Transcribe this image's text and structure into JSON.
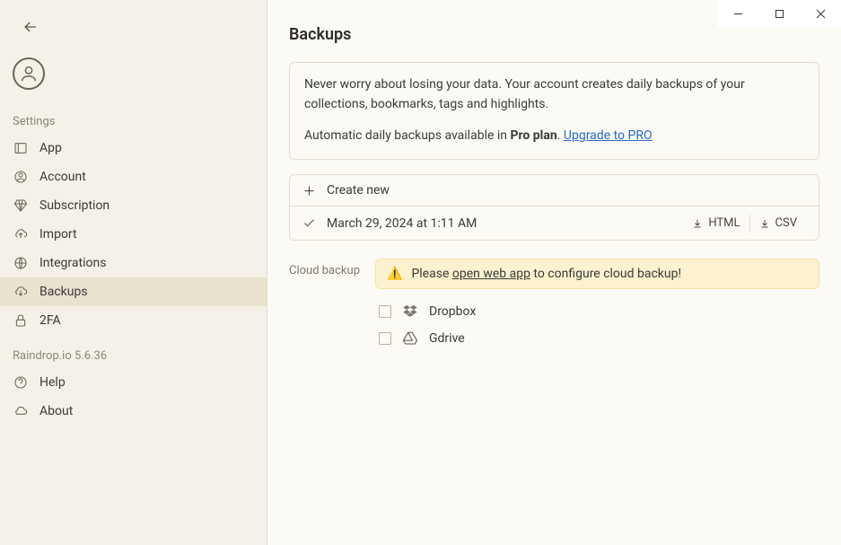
{
  "sidebar": {
    "section1_label": "Settings",
    "items1": [
      {
        "label": "App"
      },
      {
        "label": "Account"
      },
      {
        "label": "Subscription"
      },
      {
        "label": "Import"
      },
      {
        "label": "Integrations"
      },
      {
        "label": "Backups"
      },
      {
        "label": "2FA"
      }
    ],
    "section2_label": "Raindrop.io 5.6.36",
    "items2": [
      {
        "label": "Help"
      },
      {
        "label": "About"
      }
    ]
  },
  "main": {
    "title": "Backups",
    "info_line1": "Never worry about losing your data. Your account creates daily backups of your collections, bookmarks, tags and highlights.",
    "info_line2_prefix": "Automatic daily backups available in ",
    "info_line2_plan": "Pro plan",
    "info_line2_sep": ". ",
    "info_link": "Upgrade to PRO",
    "create_label": "Create new",
    "backup_date": "March 29, 2024 at 1:11 AM",
    "action_html": "HTML",
    "action_csv": "CSV",
    "cloud_label": "Cloud backup",
    "warn_prefix": "Please ",
    "warn_link": "open web app",
    "warn_suffix": " to configure cloud backup!",
    "services": [
      {
        "label": "Dropbox"
      },
      {
        "label": "Gdrive"
      }
    ]
  }
}
